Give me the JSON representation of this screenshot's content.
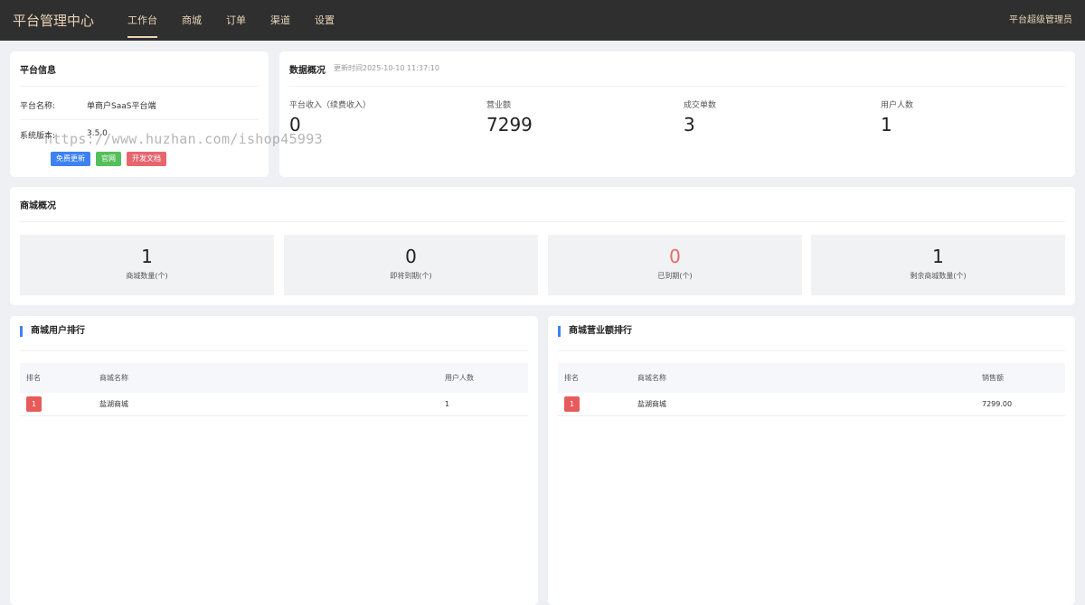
{
  "header": {
    "brand": "平台管理中心",
    "nav": [
      "工作台",
      "商城",
      "订单",
      "渠道",
      "设置"
    ],
    "active_index": 0,
    "user": "平台超级管理员"
  },
  "platform_info": {
    "title": "平台信息",
    "name_label": "平台名称:",
    "name_value": "单商户SaaS平台端",
    "version_label": "系统版本:",
    "version_value": "3.5.0",
    "buttons": [
      "免费更新",
      "官网",
      "开发文档"
    ],
    "watermark": "https://www.huzhan.com/ishop45993"
  },
  "data_overview": {
    "title": "数据概况",
    "update_time": "更新时间2025-10-10 11:37:10",
    "stats": [
      {
        "label": "平台收入（续费收入）",
        "value": "0"
      },
      {
        "label": "营业额",
        "value": "7299"
      },
      {
        "label": "成交单数",
        "value": "3"
      },
      {
        "label": "用户人数",
        "value": "1"
      }
    ]
  },
  "shop_overview": {
    "title": "商城概况",
    "boxes": [
      {
        "value": "1",
        "label": "商城数量(个)"
      },
      {
        "value": "0",
        "label": "即将到期(个)"
      },
      {
        "value": "0",
        "label": "已到期(个)"
      },
      {
        "value": "1",
        "label": "剩余商城数量(个)"
      }
    ]
  },
  "user_ranking": {
    "title": "商城用户排行",
    "columns": [
      "排名",
      "商城名称",
      "用户人数"
    ],
    "rows": [
      [
        "1",
        "盐湖商城",
        "1"
      ]
    ]
  },
  "sales_ranking": {
    "title": "商城营业额排行",
    "columns": [
      "排名",
      "商城名称",
      "销售额"
    ],
    "rows": [
      [
        "1",
        "盐湖商城",
        "7299.00"
      ]
    ]
  },
  "colors": {
    "topbar": "#2f2f2f",
    "accent_gold": "#e8d3b6",
    "blue": "#3d82f0",
    "green": "#55bf5b",
    "red": "#e66670"
  }
}
